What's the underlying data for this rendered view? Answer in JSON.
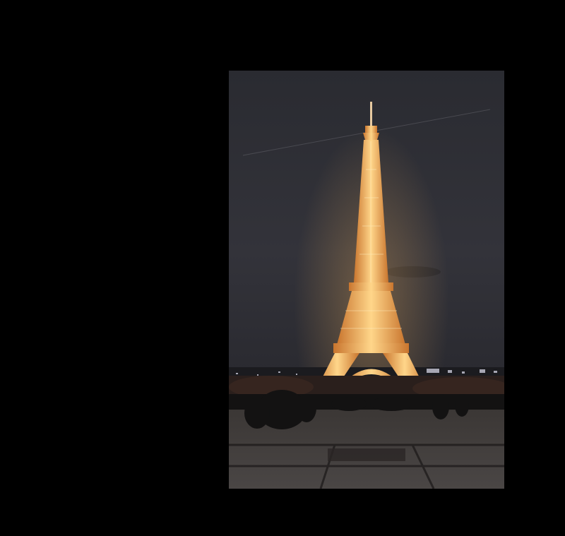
{
  "background_color": "#000000",
  "photo": {
    "subject": "eiffel-tower-icon",
    "palette": {
      "sky": "#2e2e33",
      "tower_glow": "#f2b35a",
      "tower_core": "#ffd88a",
      "plaza": "#3a3838",
      "crowd": "#151515"
    }
  }
}
